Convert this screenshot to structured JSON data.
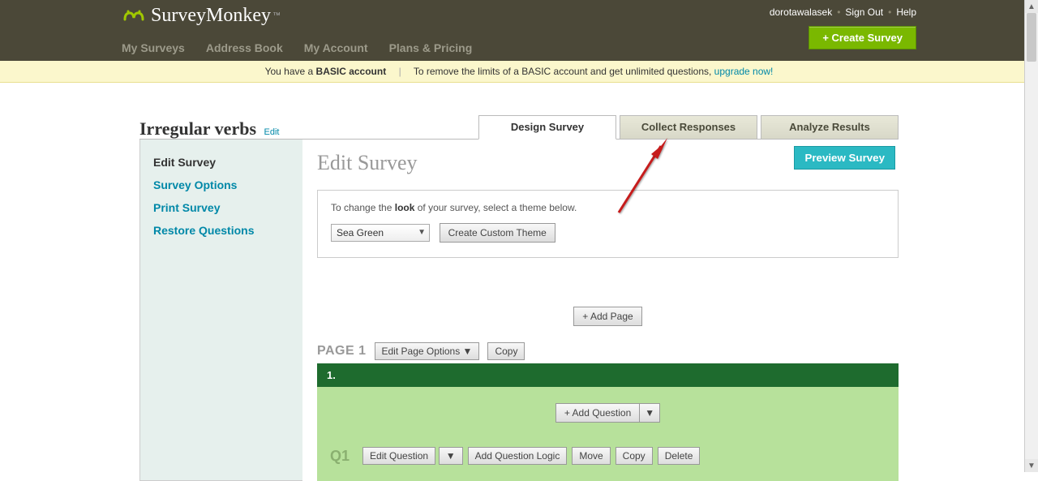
{
  "brand": "SurveyMonkey",
  "topnav": [
    "My Surveys",
    "Address Book",
    "My Account",
    "Plans & Pricing"
  ],
  "user": {
    "name": "dorotawalasek",
    "signout": "Sign Out",
    "help": "Help"
  },
  "create_survey_btn": "+ Create Survey",
  "promo": {
    "prefix": "You have a ",
    "account_type": "BASIC account",
    "text": "To remove the limits of a BASIC account and get unlimited questions, ",
    "link": "upgrade now!"
  },
  "survey": {
    "title": "Irregular verbs",
    "edit_label": "Edit"
  },
  "tabs": {
    "design": "Design Survey",
    "collect": "Collect Responses",
    "analyze": "Analyze Results"
  },
  "sidebar": {
    "edit": "Edit Survey",
    "options": "Survey Options",
    "print": "Print Survey",
    "restore": "Restore Questions"
  },
  "panel": {
    "heading": "Edit Survey",
    "preview_btn": "Preview Survey",
    "theme_prompt_prefix": "To change the ",
    "theme_prompt_bold": "look",
    "theme_prompt_suffix": " of your survey, select a theme below.",
    "theme_selected": "Sea Green",
    "custom_theme_btn": "Create Custom Theme",
    "add_page_btn": "+ Add Page",
    "page_label": "PAGE 1",
    "edit_page_options_btn": "Edit Page Options ▼",
    "copy_page_btn": "Copy",
    "page_box_title": "1.",
    "add_question_btn": "+ Add Question",
    "question_label": "Q1",
    "q_buttons": {
      "edit": "Edit Question",
      "logic": "Add Question Logic",
      "move": "Move",
      "copy": "Copy",
      "delete": "Delete"
    }
  }
}
